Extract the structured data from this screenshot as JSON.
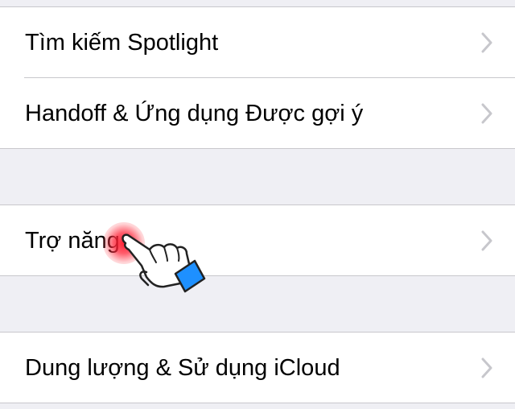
{
  "settings": {
    "group1": {
      "items": [
        {
          "label": "Tìm kiếm Spotlight"
        },
        {
          "label": "Handoff & Ứng dụng Được gợi ý"
        }
      ]
    },
    "group2": {
      "items": [
        {
          "label": "Trợ năng"
        }
      ]
    },
    "group3": {
      "items": [
        {
          "label": "Dung lượng & Sử dụng iCloud"
        }
      ]
    }
  },
  "icons": {
    "chevron": "chevron-right-icon",
    "pointer": "hand-pointer-icon",
    "touch_indicator": "tap-indicator"
  },
  "colors": {
    "background": "#efeff4",
    "cell": "#ffffff",
    "separator": "#c8c7cc",
    "chevron": "#c7c7cc",
    "text": "#000000",
    "touch": "#ff1e3c",
    "cuff": "#1e90ff"
  }
}
